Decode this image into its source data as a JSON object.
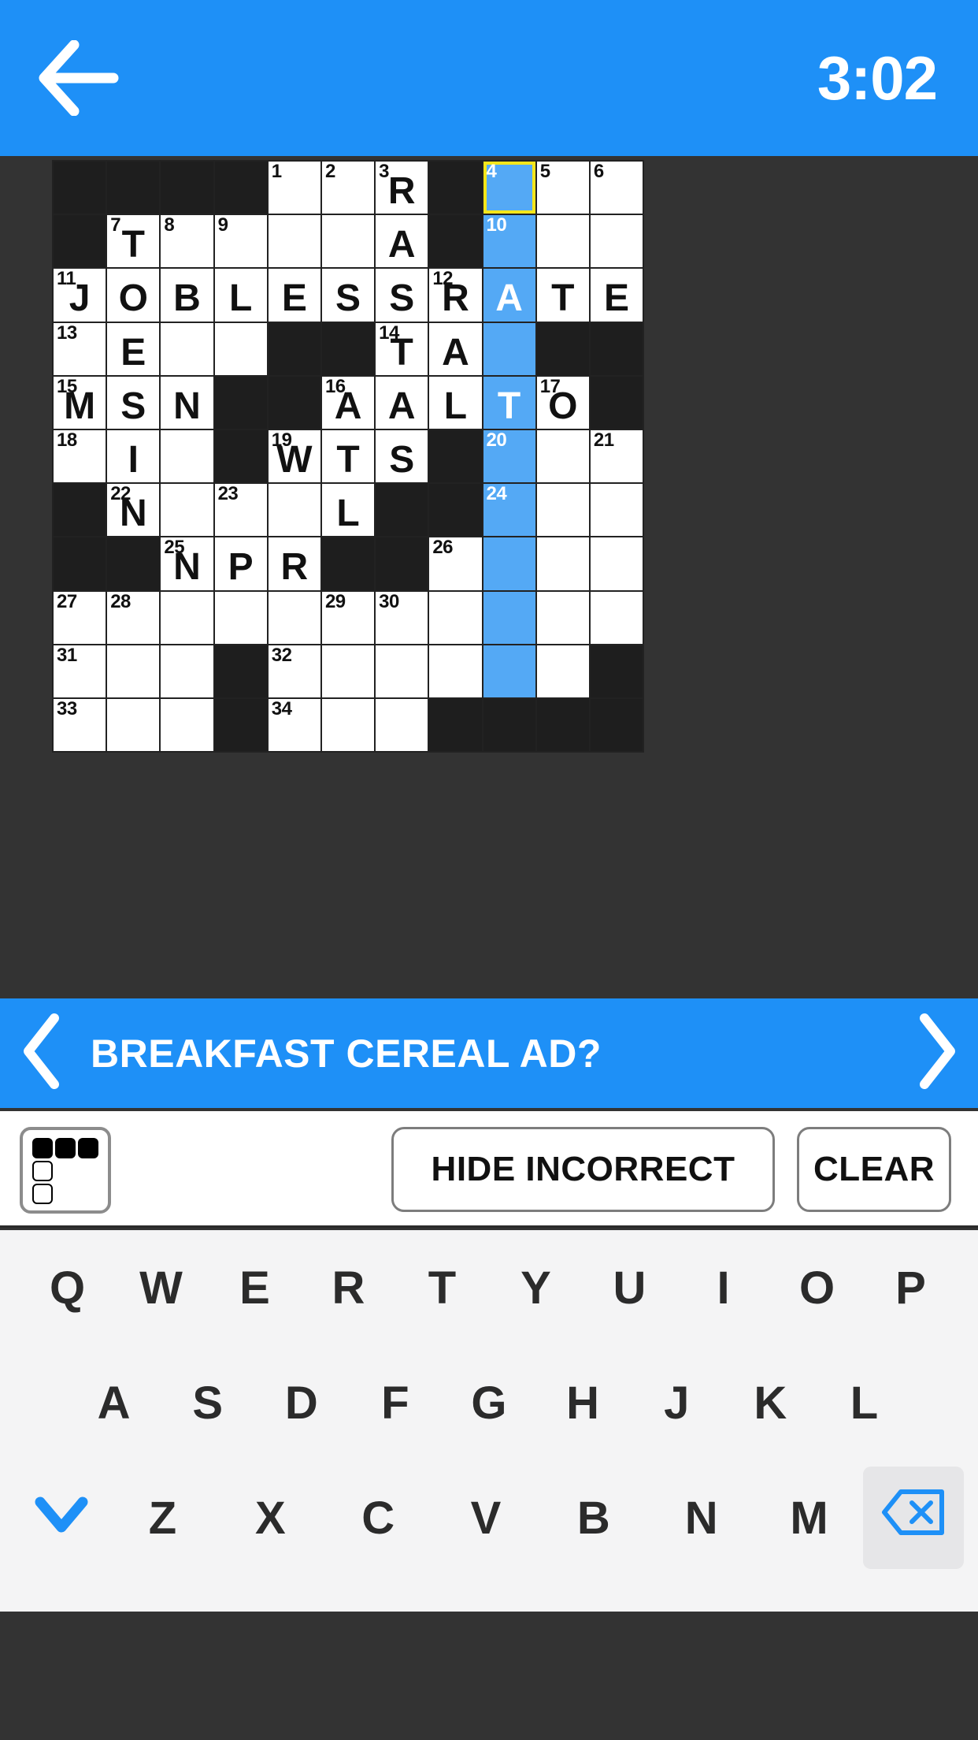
{
  "header": {
    "back_icon": "back-arrow-icon",
    "timer": "3:02"
  },
  "grid": {
    "rows": 12,
    "cols": 11,
    "colors": {
      "block": "#1e1e1e",
      "cell": "#ffffff",
      "highlight": "#54a9f5",
      "cursor_border": "#f5e61a",
      "page_bg": "#333333",
      "accent": "#1e90f7"
    },
    "cells": [
      [
        {
          "t": "block"
        },
        {
          "t": "block"
        },
        {
          "t": "block"
        },
        {
          "t": "block"
        },
        {
          "t": "open",
          "n": "1"
        },
        {
          "t": "open",
          "n": "2"
        },
        {
          "t": "open",
          "n": "3",
          "l": "R"
        },
        {
          "t": "block"
        },
        {
          "t": "cursor",
          "n": "4"
        },
        {
          "t": "open",
          "n": "5"
        },
        {
          "t": "open",
          "n": "6"
        }
      ],
      [
        {
          "t": "block"
        },
        {
          "t": "open",
          "n": "7",
          "l": "T"
        },
        {
          "t": "open",
          "n": "8"
        },
        {
          "t": "open",
          "n": "9"
        },
        {
          "t": "open"
        },
        {
          "t": "open"
        },
        {
          "t": "open",
          "l": "A"
        },
        {
          "t": "block"
        },
        {
          "t": "hl",
          "n": "10"
        },
        {
          "t": "open"
        },
        {
          "t": "open"
        }
      ],
      [
        {
          "t": "open",
          "n": "11",
          "l": "J"
        },
        {
          "t": "open",
          "l": "O"
        },
        {
          "t": "open",
          "l": "B"
        },
        {
          "t": "open",
          "l": "L"
        },
        {
          "t": "open",
          "l": "E"
        },
        {
          "t": "open",
          "l": "S"
        },
        {
          "t": "open",
          "l": "S"
        },
        {
          "t": "open",
          "n": "12",
          "l": "R"
        },
        {
          "t": "hl",
          "l": "A"
        },
        {
          "t": "open",
          "l": "T"
        },
        {
          "t": "open",
          "l": "E"
        }
      ],
      [
        {
          "t": "open",
          "n": "13"
        },
        {
          "t": "open",
          "l": "E"
        },
        {
          "t": "open"
        },
        {
          "t": "open"
        },
        {
          "t": "block"
        },
        {
          "t": "block"
        },
        {
          "t": "open",
          "n": "14",
          "l": "T"
        },
        {
          "t": "open",
          "l": "A"
        },
        {
          "t": "hl"
        },
        {
          "t": "block"
        },
        {
          "t": "block"
        }
      ],
      [
        {
          "t": "open",
          "n": "15",
          "l": "M"
        },
        {
          "t": "open",
          "l": "S"
        },
        {
          "t": "open",
          "l": "N"
        },
        {
          "t": "block"
        },
        {
          "t": "block"
        },
        {
          "t": "open",
          "n": "16",
          "l": "A"
        },
        {
          "t": "open",
          "l": "A"
        },
        {
          "t": "open",
          "l": "L"
        },
        {
          "t": "hl",
          "l": "T"
        },
        {
          "t": "open",
          "n": "17",
          "l": "O"
        },
        {
          "t": "block"
        }
      ],
      [
        {
          "t": "open",
          "n": "18"
        },
        {
          "t": "open",
          "l": "I"
        },
        {
          "t": "open"
        },
        {
          "t": "block"
        },
        {
          "t": "open",
          "n": "19",
          "l": "W"
        },
        {
          "t": "open",
          "l": "T"
        },
        {
          "t": "open",
          "l": "S"
        },
        {
          "t": "block"
        },
        {
          "t": "hl",
          "n": "20"
        },
        {
          "t": "open"
        },
        {
          "t": "open",
          "n": "21"
        }
      ],
      [
        {
          "t": "block"
        },
        {
          "t": "open",
          "n": "22",
          "l": "N"
        },
        {
          "t": "open"
        },
        {
          "t": "open",
          "n": "23"
        },
        {
          "t": "open"
        },
        {
          "t": "open",
          "l": "L"
        },
        {
          "t": "block"
        },
        {
          "t": "block"
        },
        {
          "t": "hl",
          "n": "24"
        },
        {
          "t": "open"
        },
        {
          "t": "open"
        }
      ],
      [
        {
          "t": "block"
        },
        {
          "t": "block"
        },
        {
          "t": "open",
          "n": "25",
          "l": "N"
        },
        {
          "t": "open",
          "l": "P"
        },
        {
          "t": "open",
          "l": "R"
        },
        {
          "t": "block"
        },
        {
          "t": "block"
        },
        {
          "t": "open",
          "n": "26"
        },
        {
          "t": "hl"
        },
        {
          "t": "open"
        },
        {
          "t": "open"
        }
      ],
      [
        {
          "t": "open",
          "n": "27"
        },
        {
          "t": "open",
          "n": "28"
        },
        {
          "t": "open"
        },
        {
          "t": "open"
        },
        {
          "t": "open"
        },
        {
          "t": "open",
          "n": "29"
        },
        {
          "t": "open",
          "n": "30"
        },
        {
          "t": "open"
        },
        {
          "t": "hl"
        },
        {
          "t": "open"
        },
        {
          "t": "open"
        }
      ],
      [
        {
          "t": "open",
          "n": "31"
        },
        {
          "t": "open"
        },
        {
          "t": "open"
        },
        {
          "t": "block"
        },
        {
          "t": "open",
          "n": "32"
        },
        {
          "t": "open"
        },
        {
          "t": "open"
        },
        {
          "t": "open"
        },
        {
          "t": "hl"
        },
        {
          "t": "open"
        },
        {
          "t": "block"
        }
      ],
      [
        {
          "t": "open",
          "n": "33"
        },
        {
          "t": "open"
        },
        {
          "t": "open"
        },
        {
          "t": "block"
        },
        {
          "t": "open",
          "n": "34"
        },
        {
          "t": "open"
        },
        {
          "t": "open"
        },
        {
          "t": "block"
        },
        {
          "t": "block"
        },
        {
          "t": "block"
        },
        {
          "t": "block"
        }
      ]
    ]
  },
  "clue_bar": {
    "prev_icon": "chevron-left-icon",
    "next_icon": "chevron-right-icon",
    "text": "BREAKFAST CEREAL AD?"
  },
  "toolbar": {
    "direction_toggle_icon": "across-down-toggle-icon",
    "hide_incorrect_label": "HIDE INCORRECT",
    "clear_label": "CLEAR"
  },
  "keyboard": {
    "row1": [
      "Q",
      "W",
      "E",
      "R",
      "T",
      "Y",
      "U",
      "I",
      "O",
      "P"
    ],
    "row2": [
      "A",
      "S",
      "D",
      "F",
      "G",
      "H",
      "J",
      "K",
      "L"
    ],
    "row3_letters": [
      "Z",
      "X",
      "C",
      "V",
      "B",
      "N",
      "M"
    ],
    "hide_keyboard_icon": "chevron-down-icon",
    "backspace_icon": "backspace-icon"
  }
}
